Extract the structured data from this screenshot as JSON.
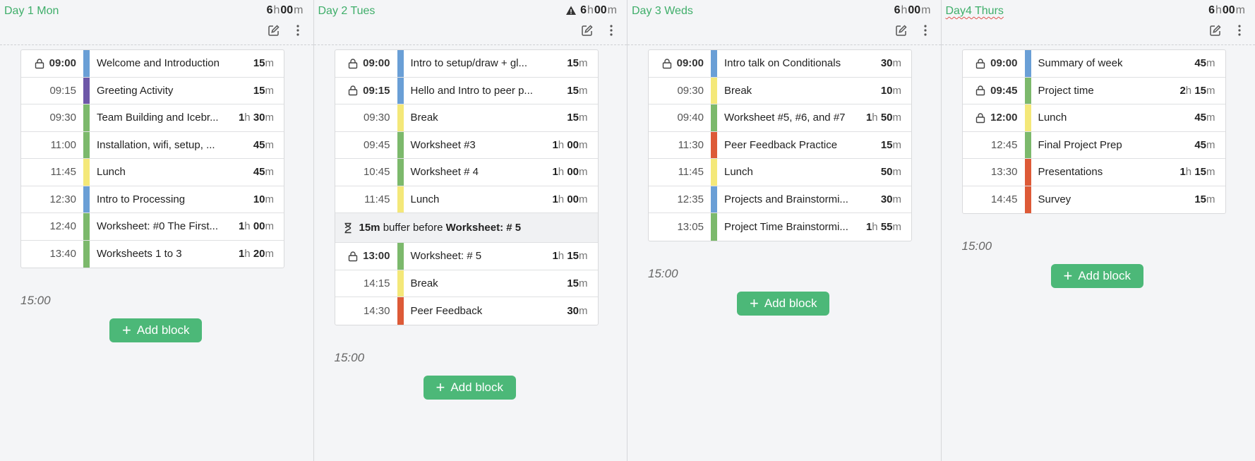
{
  "colors": {
    "blue": "#6a9fd6",
    "purple": "#6d57a8",
    "green": "#7cb96c",
    "yellow": "#f4e879",
    "red": "#dd5a37",
    "accent": "#3fae6a"
  },
  "add_label": "Add block",
  "days": [
    {
      "title": "Day 1 Mon",
      "total_h": "6",
      "total_m": "00",
      "warning": false,
      "end_time": "15:00",
      "rows": [
        {
          "time": "09:00",
          "locked": true,
          "color": "blue",
          "name": "Welcome and Introduction",
          "h": "",
          "m": "15"
        },
        {
          "time": "09:15",
          "locked": false,
          "color": "purple",
          "name": "Greeting Activity",
          "h": "",
          "m": "15"
        },
        {
          "time": "09:30",
          "locked": false,
          "color": "green",
          "name": "Team Building and Icebr...",
          "h": "1",
          "m": "30"
        },
        {
          "time": "11:00",
          "locked": false,
          "color": "green",
          "name": "Installation, wifi, setup, ...",
          "h": "",
          "m": "45"
        },
        {
          "time": "11:45",
          "locked": false,
          "color": "yellow",
          "name": "Lunch",
          "h": "",
          "m": "45"
        },
        {
          "time": "12:30",
          "locked": false,
          "color": "blue",
          "name": "Intro to Processing",
          "h": "",
          "m": "10"
        },
        {
          "time": "12:40",
          "locked": false,
          "color": "green",
          "name": "Worksheet: #0 The First...",
          "h": "1",
          "m": "00"
        },
        {
          "time": "13:40",
          "locked": false,
          "color": "green",
          "name": "Worksheets 1 to 3",
          "h": "1",
          "m": "20"
        }
      ]
    },
    {
      "title": "Day 2 Tues",
      "total_h": "6",
      "total_m": "00",
      "warning": true,
      "end_time": "15:00",
      "rows": [
        {
          "time": "09:00",
          "locked": true,
          "color": "blue",
          "name": "Intro to setup/draw + gl...",
          "h": "",
          "m": "15"
        },
        {
          "time": "09:15",
          "locked": true,
          "color": "blue",
          "name": "Hello and Intro to peer p...",
          "h": "",
          "m": "15"
        },
        {
          "time": "09:30",
          "locked": false,
          "color": "yellow",
          "name": "Break",
          "h": "",
          "m": "15"
        },
        {
          "time": "09:45",
          "locked": false,
          "color": "green",
          "name": "Worksheet #3",
          "h": "1",
          "m": "00"
        },
        {
          "time": "10:45",
          "locked": false,
          "color": "green",
          "name": "Worksheet # 4",
          "h": "1",
          "m": "00"
        },
        {
          "time": "11:45",
          "locked": false,
          "color": "yellow",
          "name": "Lunch",
          "h": "1",
          "m": "00"
        },
        {
          "buffer": true,
          "amount": "15m",
          "text": "buffer before",
          "target": "Worksheet: # 5"
        },
        {
          "time": "13:00",
          "locked": true,
          "color": "green",
          "name": "Worksheet: # 5",
          "h": "1",
          "m": "15"
        },
        {
          "time": "14:15",
          "locked": false,
          "color": "yellow",
          "name": "Break",
          "h": "",
          "m": "15"
        },
        {
          "time": "14:30",
          "locked": false,
          "color": "red",
          "name": "Peer Feedback",
          "h": "",
          "m": "30"
        }
      ]
    },
    {
      "title": "Day 3 Weds",
      "total_h": "6",
      "total_m": "00",
      "warning": false,
      "end_time": "15:00",
      "rows": [
        {
          "time": "09:00",
          "locked": true,
          "color": "blue",
          "name": "Intro talk on Conditionals",
          "h": "",
          "m": "30"
        },
        {
          "time": "09:30",
          "locked": false,
          "color": "yellow",
          "name": "Break",
          "h": "",
          "m": "10"
        },
        {
          "time": "09:40",
          "locked": false,
          "color": "green",
          "name": "Worksheet #5, #6, and #7",
          "h": "1",
          "m": "50"
        },
        {
          "time": "11:30",
          "locked": false,
          "color": "red",
          "name": "Peer Feedback Practice",
          "h": "",
          "m": "15"
        },
        {
          "time": "11:45",
          "locked": false,
          "color": "yellow",
          "name": "Lunch",
          "h": "",
          "m": "50"
        },
        {
          "time": "12:35",
          "locked": false,
          "color": "blue",
          "name": "Projects and Brainstormi...",
          "h": "",
          "m": "30"
        },
        {
          "time": "13:05",
          "locked": false,
          "color": "green",
          "name": "Project Time Brainstormi...",
          "h": "1",
          "m": "55"
        }
      ]
    },
    {
      "title": "Day4 Thurs",
      "total_h": "6",
      "total_m": "00",
      "warning": false,
      "end_time": "15:00",
      "rows": [
        {
          "time": "09:00",
          "locked": true,
          "color": "blue",
          "name": "Summary of week",
          "h": "",
          "m": "45"
        },
        {
          "time": "09:45",
          "locked": true,
          "color": "green",
          "name": "Project time",
          "h": "2",
          "m": "15"
        },
        {
          "time": "12:00",
          "locked": true,
          "color": "yellow",
          "name": "Lunch",
          "h": "",
          "m": "45"
        },
        {
          "time": "12:45",
          "locked": false,
          "color": "green",
          "name": "Final Project Prep",
          "h": "",
          "m": "45"
        },
        {
          "time": "13:30",
          "locked": false,
          "color": "red",
          "name": "Presentations",
          "h": "1",
          "m": "15"
        },
        {
          "time": "14:45",
          "locked": false,
          "color": "red",
          "name": "Survey",
          "h": "",
          "m": "15"
        }
      ]
    }
  ]
}
